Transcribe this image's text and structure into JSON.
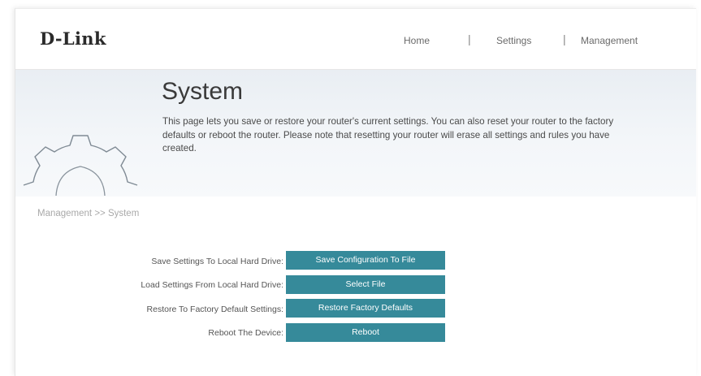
{
  "header": {
    "logo": "D-Link",
    "nav": {
      "home": "Home",
      "settings": "Settings",
      "management": "Management",
      "separator": "|"
    }
  },
  "banner": {
    "title": "System",
    "description": "This page lets you save or restore your router's current settings. You can also reset your router to the factory defaults or reboot the router. Please note that resetting your router will erase all settings and rules you have created.",
    "icon": "gear-icon"
  },
  "breadcrumb": "Management >> System",
  "rows": [
    {
      "label": "Save Settings To Local Hard Drive:",
      "button": "Save Configuration To File"
    },
    {
      "label": "Load Settings From Local Hard Drive:",
      "button": "Select File"
    },
    {
      "label": "Restore To Factory Default Settings:",
      "button": "Restore Factory Defaults"
    },
    {
      "label": "Reboot The Device:",
      "button": "Reboot"
    }
  ],
  "colors": {
    "button": "#368a9a",
    "banner": "#eef2f6"
  }
}
